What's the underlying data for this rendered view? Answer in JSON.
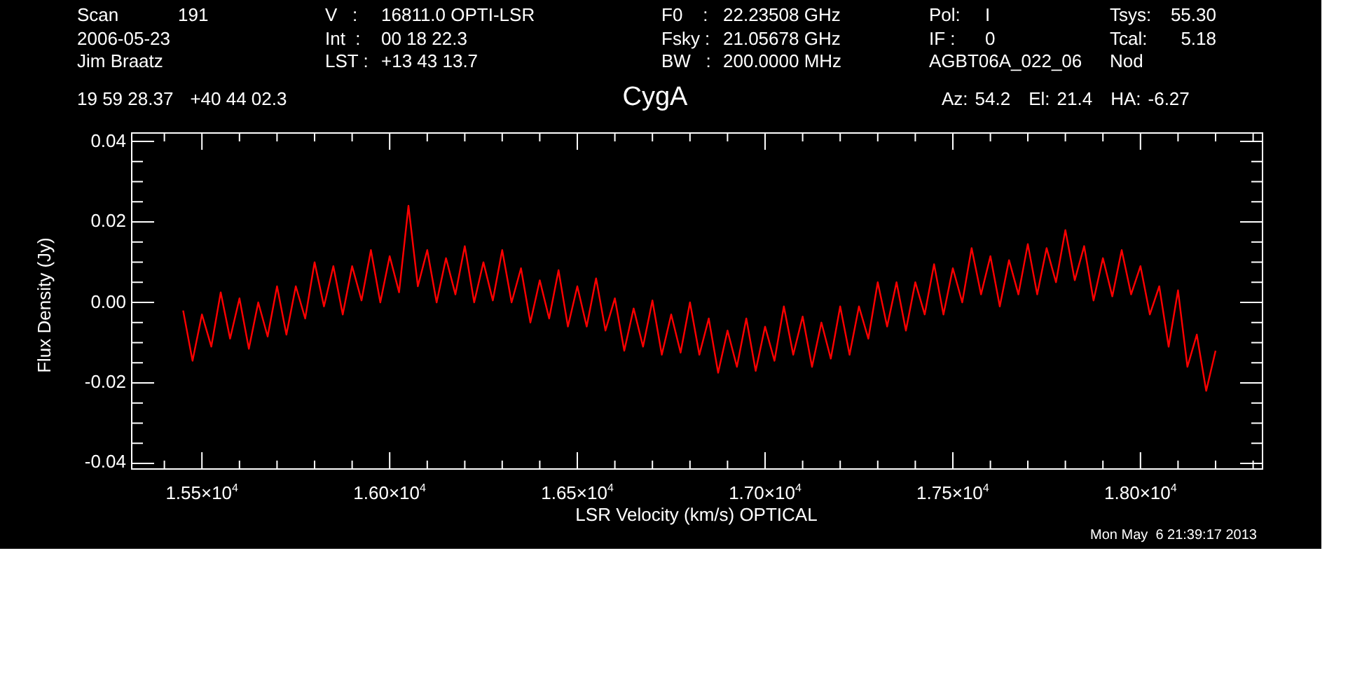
{
  "header": {
    "columns": [
      {
        "items": [
          {
            "label": "Scan",
            "value": "191"
          },
          {
            "value": "2006-05-23"
          },
          {
            "value": "Jim Braatz"
          }
        ]
      },
      {
        "items": [
          {
            "label": "V   :",
            "value": "16811.0 OPTI-LSR"
          },
          {
            "label": "Int  :",
            "value": "00 18 22.3"
          },
          {
            "label": "LST :",
            "value": "+13 43 13.7"
          }
        ]
      },
      {
        "items": [
          {
            "label": "F0    :",
            "value": "22.23508 GHz"
          },
          {
            "label": "Fsky :",
            "value": "21.05678 GHz"
          },
          {
            "label": "BW   :",
            "value": "200.0000 MHz"
          }
        ]
      },
      {
        "items": [
          {
            "label": "Pol:",
            "value": "I"
          },
          {
            "label": "IF :",
            "value": "0"
          },
          {
            "value": "AGBT06A_022_06"
          }
        ]
      },
      {
        "items": [
          {
            "label": "Tsys:",
            "value": "55.30"
          },
          {
            "label": "Tcal:",
            "value": "5.18"
          },
          {
            "value": "Nod"
          }
        ]
      }
    ],
    "ra": "19 59 28.37",
    "dec": "+40 44 02.3",
    "source": "CygA",
    "pointing": [
      {
        "label": "Az:",
        "value": "54.2"
      },
      {
        "label": "El:",
        "value": "21.4"
      },
      {
        "label": "HA:",
        "value": "-6.27"
      }
    ]
  },
  "plot": {
    "chart_data": {
      "type": "line",
      "xlabel": "LSR Velocity (km/s) OPTICAL",
      "ylabel": "Flux Density (Jy)",
      "xlim": [
        15313,
        18325
      ],
      "ylim": [
        -0.0414,
        0.0421
      ],
      "xticks": [
        {
          "value": 15500,
          "label": "1.55×10$^{4}$"
        },
        {
          "value": 16000,
          "label": "1.60×10$^{4}$"
        },
        {
          "value": 16500,
          "label": "1.65×10$^{4}$"
        },
        {
          "value": 17000,
          "label": "1.70×10$^{4}$"
        },
        {
          "value": 17500,
          "label": "1.75×10$^{4}$"
        },
        {
          "value": 18000,
          "label": "1.80×10$^{4}$"
        }
      ],
      "yticks": [
        {
          "value": 0.04,
          "label": "0.04"
        },
        {
          "value": 0.02,
          "label": "0.02"
        },
        {
          "value": 0,
          "label": "0.00"
        },
        {
          "value": -0.02,
          "label": "-0.02"
        },
        {
          "value": -0.04,
          "label": "-0.04"
        }
      ],
      "x": [
        15450,
        15475,
        15500,
        15525,
        15550,
        15575,
        15600,
        15625,
        15650,
        15675,
        15700,
        15725,
        15750,
        15775,
        15800,
        15825,
        15850,
        15875,
        15900,
        15925,
        15950,
        15975,
        16000,
        16025,
        16050,
        16075,
        16100,
        16125,
        16150,
        16175,
        16200,
        16225,
        16250,
        16275,
        16300,
        16325,
        16350,
        16375,
        16400,
        16425,
        16450,
        16475,
        16500,
        16525,
        16550,
        16575,
        16600,
        16625,
        16650,
        16675,
        16700,
        16725,
        16750,
        16775,
        16800,
        16825,
        16850,
        16875,
        16900,
        16925,
        16950,
        16975,
        17000,
        17025,
        17050,
        17075,
        17100,
        17125,
        17150,
        17175,
        17200,
        17225,
        17250,
        17275,
        17300,
        17325,
        17350,
        17375,
        17400,
        17425,
        17450,
        17475,
        17500,
        17525,
        17550,
        17575,
        17600,
        17625,
        17650,
        17675,
        17700,
        17725,
        17750,
        17775,
        17800,
        17825,
        17850,
        17875,
        17900,
        17925,
        17950,
        17975,
        18000,
        18025,
        18050,
        18075,
        18100,
        18125,
        18150,
        18175,
        18200
      ],
      "series": [
        {
          "color": "#ff0000",
          "values": [
            -0.002,
            -0.0145,
            -0.003,
            -0.011,
            0.0025,
            -0.009,
            0.001,
            -0.0115,
            0.0,
            -0.0085,
            0.004,
            -0.008,
            0.004,
            -0.004,
            0.01,
            -0.001,
            0.009,
            -0.003,
            0.009,
            0.0005,
            0.013,
            0.0,
            0.0115,
            0.0025,
            0.024,
            0.004,
            0.013,
            0.0,
            0.011,
            0.002,
            0.014,
            0.0,
            0.01,
            0.0005,
            0.013,
            0.0,
            0.0085,
            -0.005,
            0.0055,
            -0.004,
            0.008,
            -0.006,
            0.004,
            -0.006,
            0.006,
            -0.007,
            0.001,
            -0.012,
            -0.0015,
            -0.011,
            0.0005,
            -0.013,
            -0.003,
            -0.0125,
            0.0,
            -0.013,
            -0.004,
            -0.0175,
            -0.007,
            -0.016,
            -0.004,
            -0.017,
            -0.006,
            -0.0145,
            -0.001,
            -0.013,
            -0.0035,
            -0.016,
            -0.005,
            -0.014,
            -0.001,
            -0.013,
            -0.001,
            -0.009,
            0.005,
            -0.006,
            0.005,
            -0.007,
            0.005,
            -0.003,
            0.0095,
            -0.003,
            0.0085,
            0.0,
            0.0135,
            0.002,
            0.0115,
            -0.001,
            0.0105,
            0.002,
            0.0145,
            0.002,
            0.0135,
            0.005,
            0.018,
            0.0055,
            0.014,
            0.0005,
            0.011,
            0.0015,
            0.013,
            0.002,
            0.009,
            -0.003,
            0.004,
            -0.011,
            0.003,
            -0.016,
            -0.008,
            -0.022,
            -0.012
          ]
        }
      ]
    }
  },
  "timestamp": "Mon May  6 21:39:17 2013"
}
